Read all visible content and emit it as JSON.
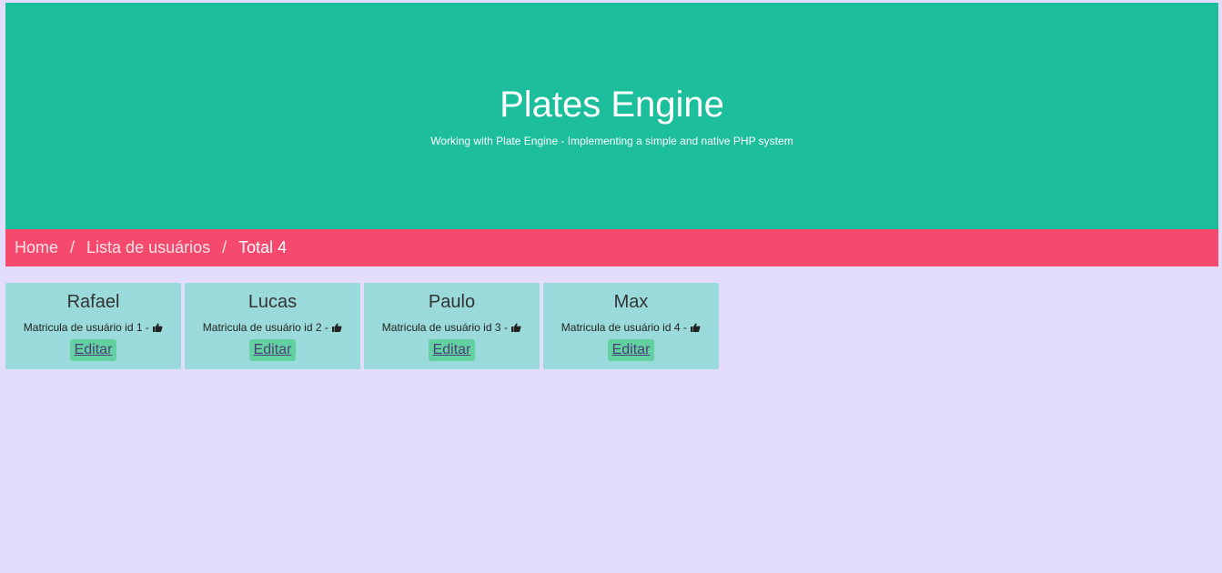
{
  "hero": {
    "title": "Plates Engine",
    "subtitle": "Working with Plate Engine - Implementing a simple and native PHP system"
  },
  "breadcrumb": {
    "home": "Home",
    "list": "Lista de usuários",
    "separator": "/",
    "current": "Total 4"
  },
  "users": [
    {
      "name": "Rafael",
      "text": "Matricula de usuário id 1 - ",
      "icon": "thumbs-up-icon",
      "edit_label": "Editar"
    },
    {
      "name": "Lucas",
      "text": "Matricula de usuário id 2 - ",
      "icon": "thumbs-up-icon",
      "edit_label": "Editar"
    },
    {
      "name": "Paulo",
      "text": "Matricula de usuário id 3 - ",
      "icon": "thumbs-up-icon",
      "edit_label": "Editar"
    },
    {
      "name": "Max",
      "text": "Matricula de usuário id 4 - ",
      "icon": "thumbs-up-icon",
      "edit_label": "Editar"
    }
  ],
  "colors": {
    "hero": "#1dbe9c",
    "breadcrumb": "#f54a6d",
    "background": "#e4dcfb",
    "card": "#9bdada",
    "button": "#62d0a0"
  }
}
